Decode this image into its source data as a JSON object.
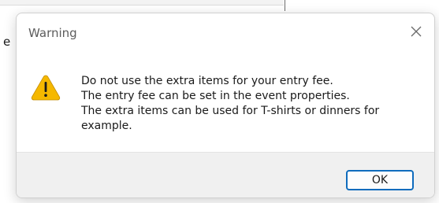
{
  "background": {
    "fragment_text": "e"
  },
  "dialog": {
    "title": "Warning",
    "close_icon": "close-icon",
    "warning_icon": "warning-icon",
    "message_lines": [
      "Do not use the extra items for your entry fee.",
      "The entry fee can be set in the event properties.",
      "The extra items can be used for T-shirts or dinners for",
      "example."
    ],
    "ok_label": "OK"
  },
  "colors": {
    "accent": "#0f6cbd",
    "warning_fill": "#f5b800",
    "footer_bg": "#f0f0f0"
  }
}
